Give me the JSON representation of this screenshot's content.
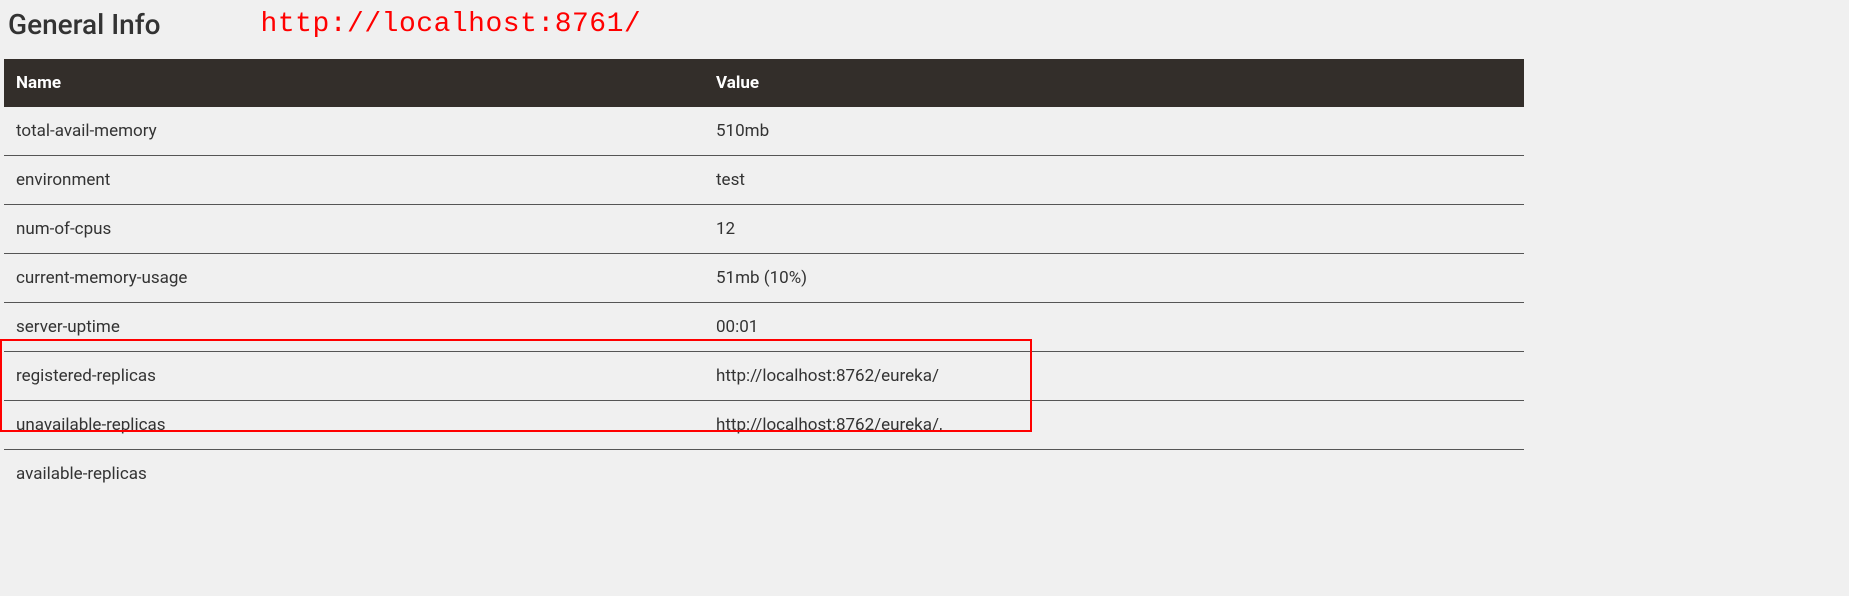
{
  "header": {
    "title": "General Info",
    "annotation_url": "http://localhost:8761/"
  },
  "table": {
    "columns": {
      "name": "Name",
      "value": "Value"
    },
    "rows": [
      {
        "name": "total-avail-memory",
        "value": "510mb"
      },
      {
        "name": "environment",
        "value": "test"
      },
      {
        "name": "num-of-cpus",
        "value": "12"
      },
      {
        "name": "current-memory-usage",
        "value": "51mb (10%)"
      },
      {
        "name": "server-uptime",
        "value": "00:01"
      },
      {
        "name": "registered-replicas",
        "value": "http://localhost:8762/eureka/"
      },
      {
        "name": "unavailable-replicas",
        "value": "http://localhost:8762/eureka/,"
      },
      {
        "name": "available-replicas",
        "value": ""
      }
    ]
  }
}
